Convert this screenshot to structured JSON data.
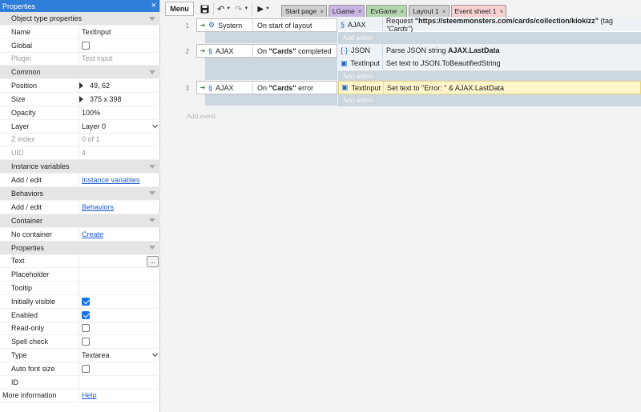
{
  "properties": {
    "title": "Properties",
    "close": "×",
    "sections": {
      "object_type": "Object type properties",
      "common": "Common",
      "instance_vars": "Instance variables",
      "behaviors": "Behaviors",
      "container": "Container",
      "properties": "Properties"
    },
    "name": {
      "label": "Name",
      "value": "TextInput"
    },
    "global": {
      "label": "Global",
      "checked": false
    },
    "plugin": {
      "label": "Plugin",
      "value": "Text input"
    },
    "position": {
      "label": "Position",
      "value": "49, 62"
    },
    "size": {
      "label": "Size",
      "value": "375 x 398"
    },
    "opacity": {
      "label": "Opacity",
      "value": "100%"
    },
    "layer": {
      "label": "Layer",
      "value": "Layer 0"
    },
    "zindex": {
      "label": "Z index",
      "value": "0 of 1"
    },
    "uid": {
      "label": "UID",
      "value": "4"
    },
    "iv_add": {
      "label": "Add / edit",
      "link": "Instance variables"
    },
    "beh_add": {
      "label": "Add / edit",
      "link": "Behaviors"
    },
    "container": {
      "label": "No container",
      "link": "Create"
    },
    "text": {
      "label": "Text",
      "value": "",
      "button": "..."
    },
    "placeholder": {
      "label": "Placeholder",
      "value": ""
    },
    "tooltip": {
      "label": "Tooltip",
      "value": ""
    },
    "visible": {
      "label": "Initially visible",
      "checked": true
    },
    "enabled": {
      "label": "Enabled",
      "checked": true
    },
    "readonly": {
      "label": "Read-only",
      "checked": false
    },
    "spellcheck": {
      "label": "Spell check",
      "checked": false
    },
    "type": {
      "label": "Type",
      "value": "Textarea"
    },
    "autofont": {
      "label": "Auto font size",
      "checked": false
    },
    "id": {
      "label": "ID",
      "value": ""
    },
    "more": {
      "label": "More information",
      "link": "Help"
    }
  },
  "toolbar": {
    "menu": "Menu",
    "tabs": [
      {
        "label": "Start page",
        "color": "#cfcfcf"
      },
      {
        "label": "LGame",
        "color": "#c9b6e4"
      },
      {
        "label": "EvGame",
        "color": "#b5d7b0"
      },
      {
        "label": "Layout 1",
        "color": "#cfcfcf"
      },
      {
        "label": "Event sheet 1",
        "color": "#f7d0d0"
      }
    ]
  },
  "events": [
    {
      "number": "1",
      "object": "System",
      "condition": "On start of layout",
      "actions": [
        {
          "object": "AJAX",
          "pre": "Request ",
          "bold": "\"https://steemmonsters.com/cards/collection/kiokizz\"",
          "post": " (tag ",
          "italic": "\"Cards\"",
          "end": ")"
        }
      ],
      "add_action": "Add action"
    },
    {
      "number": "2",
      "object": "AJAX",
      "cond_pre": "On ",
      "cond_bold": "\"Cards\"",
      "cond_post": " completed",
      "actions": [
        {
          "object": "JSON",
          "pre": "Parse JSON string ",
          "bold": "AJAX.LastData"
        },
        {
          "object": "TextInput",
          "pre": "Set text to JSON.ToBeautifiedString"
        }
      ],
      "add_action": "Add action"
    },
    {
      "number": "3",
      "object": "AJAX",
      "cond_pre": "On ",
      "cond_bold": "\"Cards\"",
      "cond_post": " error",
      "actions": [
        {
          "object": "TextInput",
          "pre": "Set text to \"Error: \" & AJAX.LastData"
        }
      ],
      "add_action": "Add action"
    }
  ],
  "add_event": "Add event"
}
